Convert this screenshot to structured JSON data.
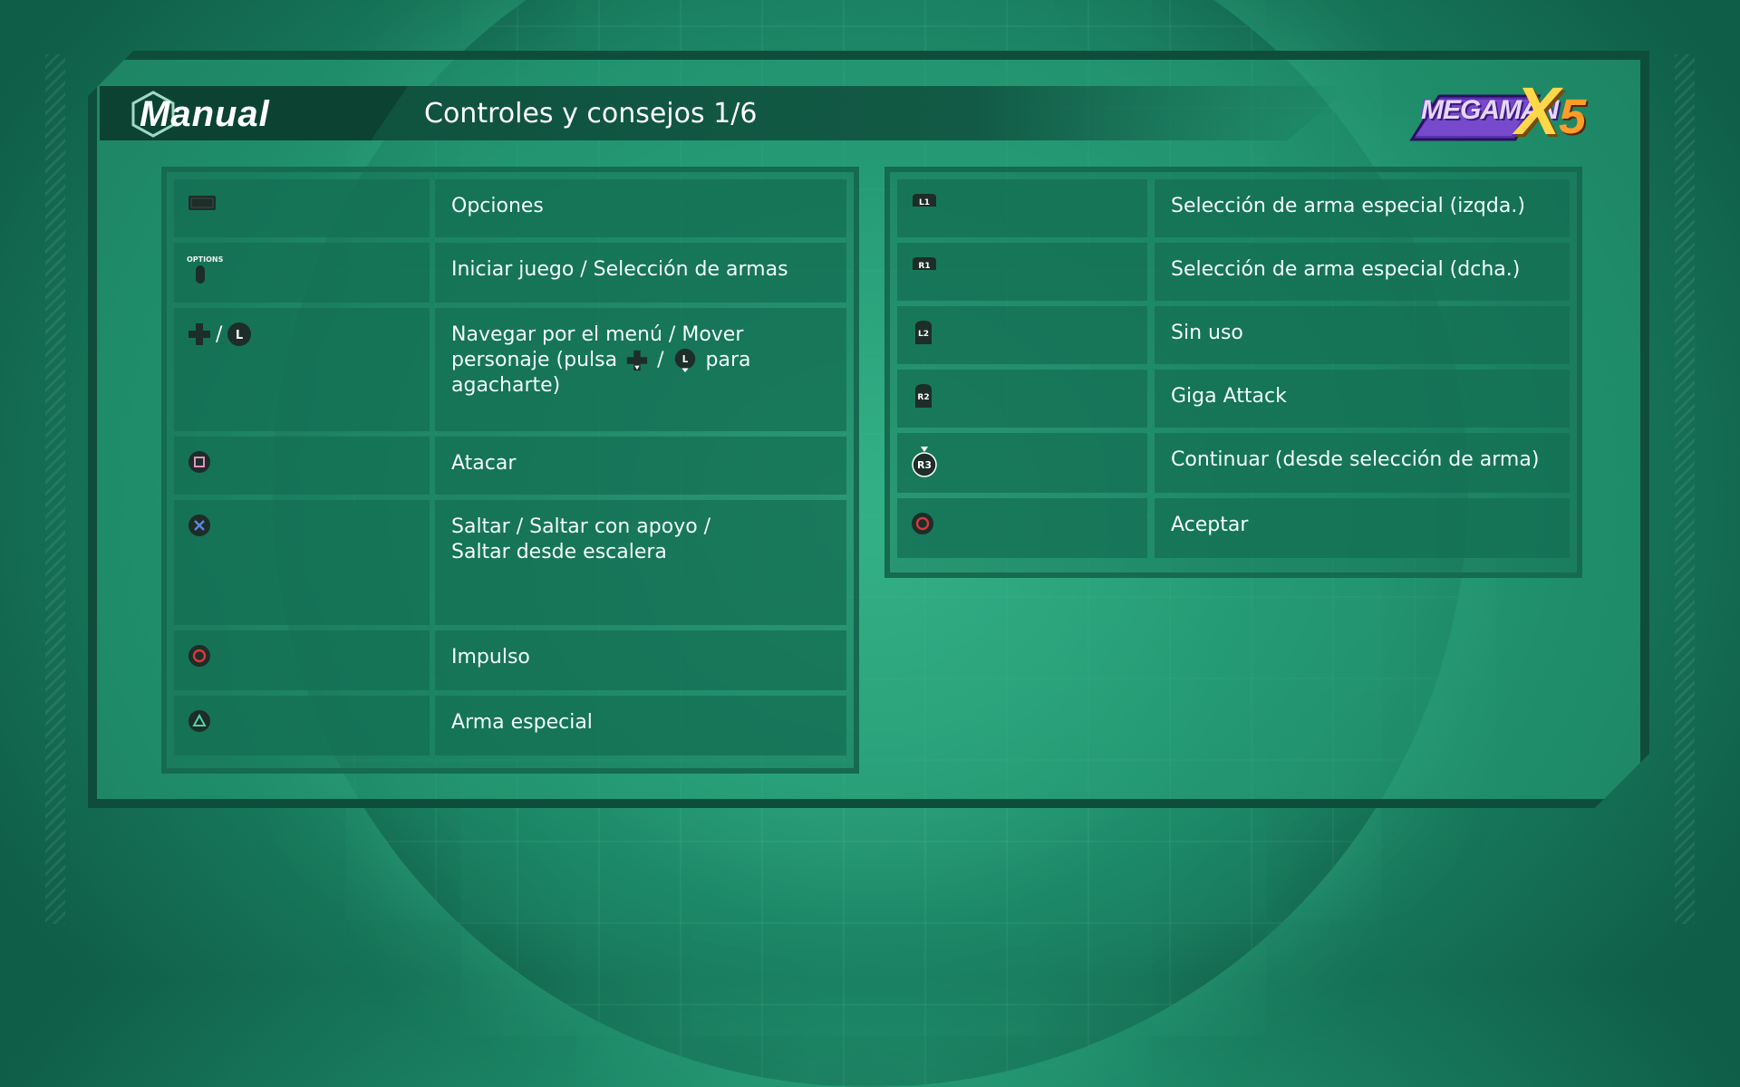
{
  "header": {
    "manual_label": "Manual",
    "page_title": "Controles y consejos 1/6"
  },
  "logo": {
    "text": "MEGAMAN",
    "x": "X",
    "num": "5"
  },
  "left_rows": [
    {
      "icon": "touchpad-icon",
      "label": "Opciones"
    },
    {
      "icon": "options-button-icon",
      "icon_text": "OPTIONS",
      "label": "Iniciar juego / Selección de armas"
    },
    {
      "icon": "dpad-left-stick-icon",
      "sep": "/",
      "stick": "L",
      "label_a": "Navegar por el menú / Mover personaje (pulsa",
      "label_b": "para agacharte)"
    },
    {
      "icon": "square-button-icon",
      "label": "Atacar"
    },
    {
      "icon": "cross-button-icon",
      "label": "Saltar / Saltar con apoyo / Saltar desde escalera"
    },
    {
      "icon": "circle-button-icon",
      "label": "Impulso"
    },
    {
      "icon": "triangle-button-icon",
      "label": "Arma especial"
    }
  ],
  "right_rows": [
    {
      "icon": "l1-button-icon",
      "icon_text": "L1",
      "label": "Selección de arma especial (izqda.)"
    },
    {
      "icon": "r1-button-icon",
      "icon_text": "R1",
      "label": "Selección de arma especial (dcha.)"
    },
    {
      "icon": "l2-button-icon",
      "icon_text": "L2",
      "label": "Sin uso"
    },
    {
      "icon": "r2-button-icon",
      "icon_text": "R2",
      "label": "Giga Attack"
    },
    {
      "icon": "r3-button-icon",
      "icon_text": "R3",
      "label": "Continuar (desde selección de arma)"
    },
    {
      "icon": "circle-button-icon",
      "label": "Aceptar"
    }
  ],
  "colors": {
    "bg": "#1f8f6c",
    "panel_border": "#0f4d3b",
    "cell": "#146e52",
    "text": "#f1fff8",
    "circle_red": "#d63a3a",
    "cross_blue": "#5a86e6"
  }
}
